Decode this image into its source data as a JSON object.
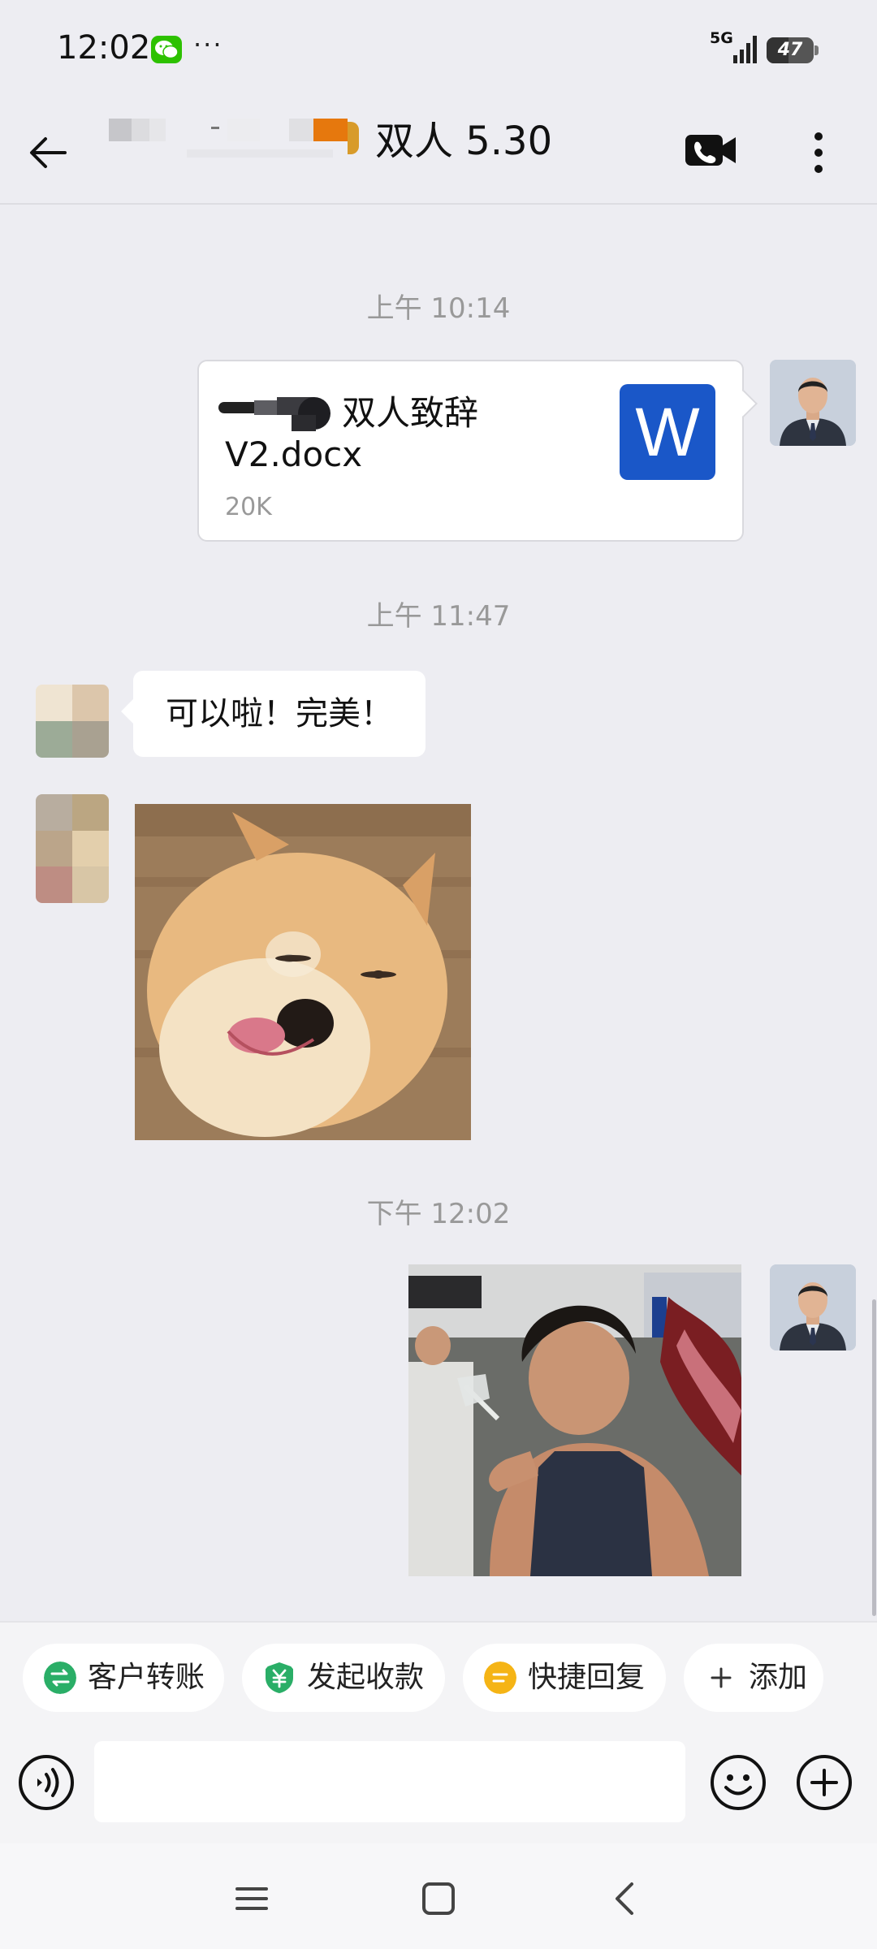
{
  "status_bar": {
    "time": "12:02",
    "more": "···",
    "network": "5G",
    "battery_level": "47",
    "battery_fraction": 0.47
  },
  "header": {
    "title": "双人 5.30",
    "back_icon": "arrow-left-icon",
    "video_icon": "video-call-icon",
    "menu_icon": "more-vertical-icon"
  },
  "messages": [
    {
      "type": "timestamp",
      "text": "上午 10:14"
    },
    {
      "type": "file",
      "sender": "me",
      "name_line1": "双人致辞",
      "name_line2": "V2.docx",
      "size": "20K",
      "icon_letter": "W"
    },
    {
      "type": "timestamp",
      "text": "上午 11:47"
    },
    {
      "type": "text",
      "sender": "other",
      "text": "可以啦！完美！"
    },
    {
      "type": "sticker",
      "sender": "other",
      "depicts": "shiba-dog-sticker"
    },
    {
      "type": "timestamp",
      "text": "下午 12:02"
    },
    {
      "type": "sticker",
      "sender": "me",
      "depicts": "man-drinking-sticker"
    }
  ],
  "quick_actions": [
    {
      "label": "客户转账",
      "icon": "transfer-icon",
      "color": "#2aae67"
    },
    {
      "label": "发起收款",
      "icon": "yuan-shield-icon",
      "color": "#2aae67"
    },
    {
      "label": "快捷回复",
      "icon": "quick-reply-icon",
      "color": "#f5b415"
    },
    {
      "label": "添加",
      "icon": "plus-icon",
      "color": "#333333"
    }
  ],
  "input": {
    "value": "",
    "placeholder": ""
  },
  "colors": {
    "background": "#ededf2",
    "bubble_other": "#ffffff",
    "word_blue": "#1a57c8",
    "timestamp": "#999999"
  }
}
